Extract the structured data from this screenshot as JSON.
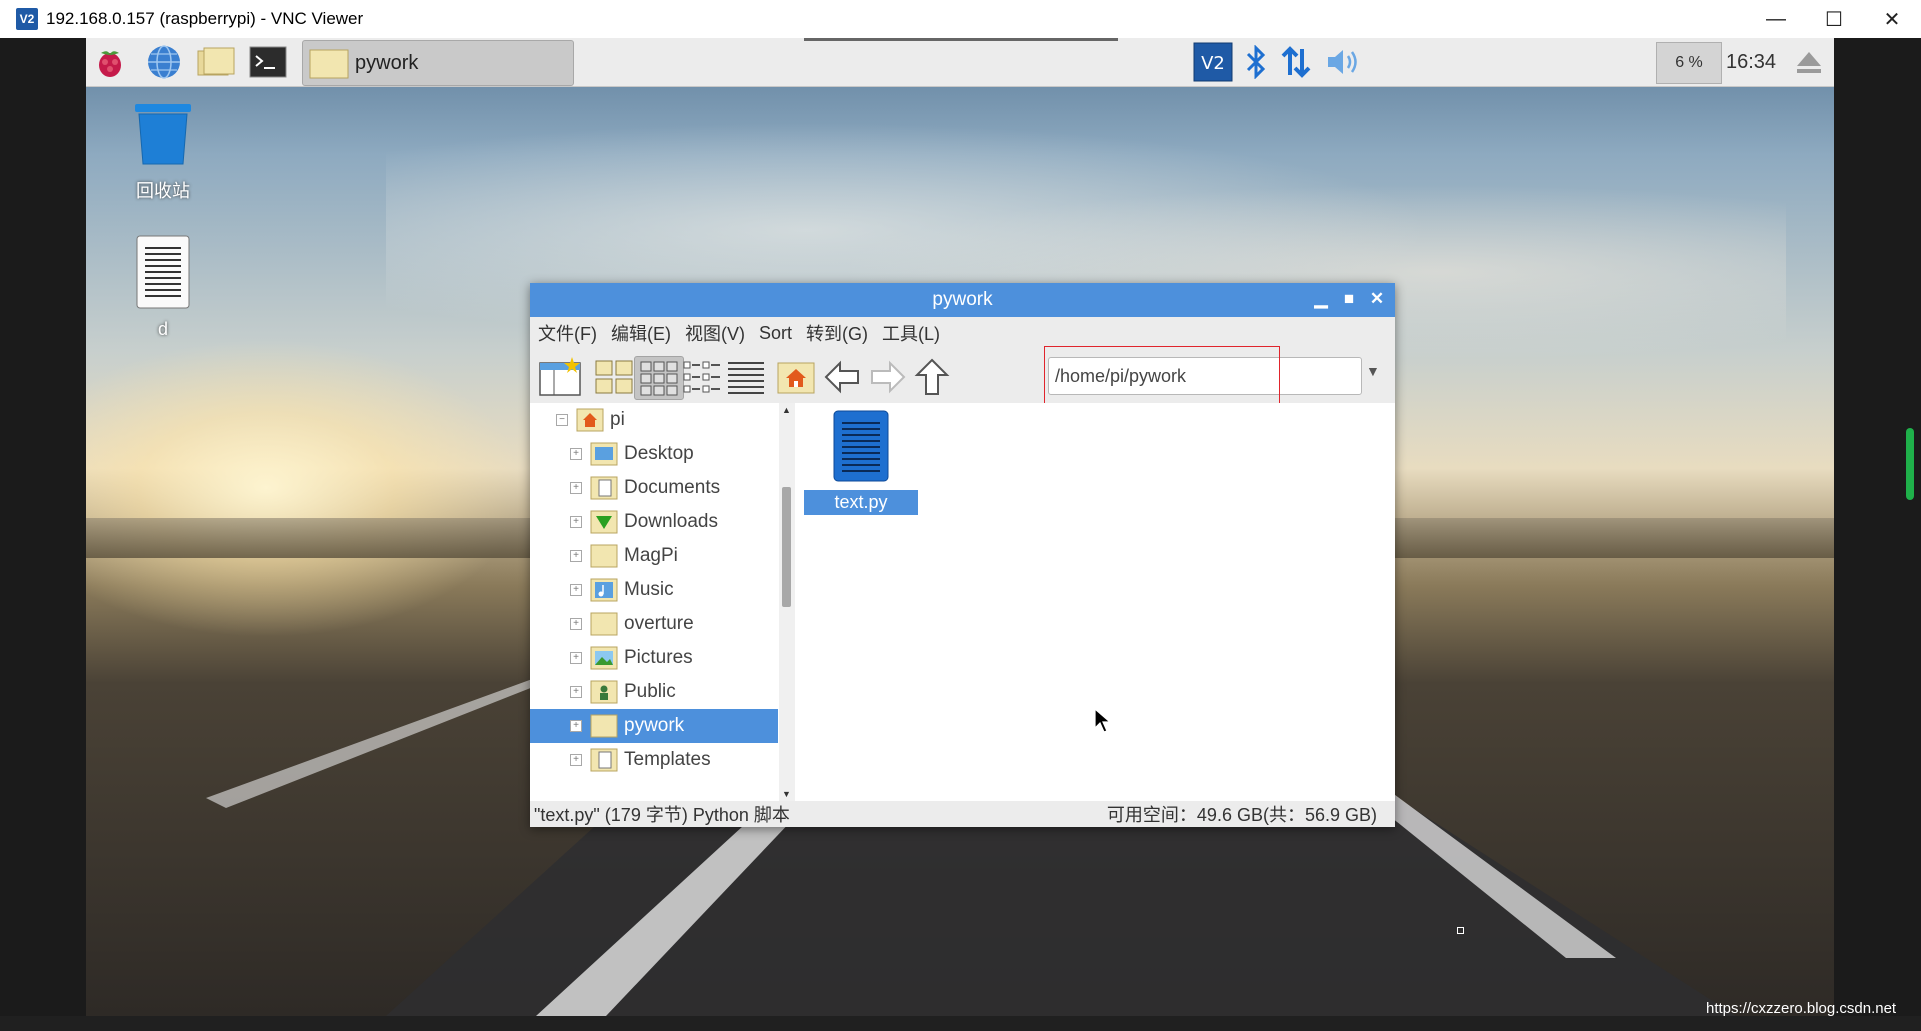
{
  "vnc": {
    "logo_text": "V2",
    "title": "192.168.0.157 (raspberrypi) - VNC Viewer",
    "minimize": "—",
    "maximize": "☐",
    "close": "✕"
  },
  "panel": {
    "icons": [
      "raspberry-menu-icon",
      "web-browser-icon",
      "file-manager-icon",
      "terminal-icon"
    ],
    "task": {
      "label": "pywork"
    },
    "cpu": "6 %",
    "clock": "16:34",
    "tray_icons": [
      "vnc-server-icon",
      "bluetooth-icon",
      "network-icon",
      "volume-icon",
      "eject-icon"
    ]
  },
  "desktop": {
    "icons": [
      {
        "label": "回收站"
      },
      {
        "label": "d"
      }
    ]
  },
  "file_manager": {
    "title": "pywork",
    "menu": [
      "文件(F)",
      "编辑(E)",
      "视图(V)",
      "Sort",
      "转到(G)",
      "工具(L)"
    ],
    "path": "/home/pi/pywork",
    "tree": {
      "root": "pi",
      "items": [
        {
          "label": "Desktop"
        },
        {
          "label": "Documents"
        },
        {
          "label": "Downloads"
        },
        {
          "label": "MagPi"
        },
        {
          "label": "Music"
        },
        {
          "label": "overture"
        },
        {
          "label": "Pictures"
        },
        {
          "label": "Public"
        },
        {
          "label": "pywork"
        },
        {
          "label": "Templates"
        }
      ],
      "selected": "pywork"
    },
    "files": [
      {
        "name": "text.py"
      }
    ],
    "status_left": "\"text.py\" (179 字节) Python 脚本",
    "status_right": "可用空间：49.6 GB(共：56.9 GB)"
  },
  "watermark": "https://cxzzero.blog.csdn.net",
  "colors": {
    "accent": "#4d90dc",
    "highlight_box": "#e0242c"
  }
}
